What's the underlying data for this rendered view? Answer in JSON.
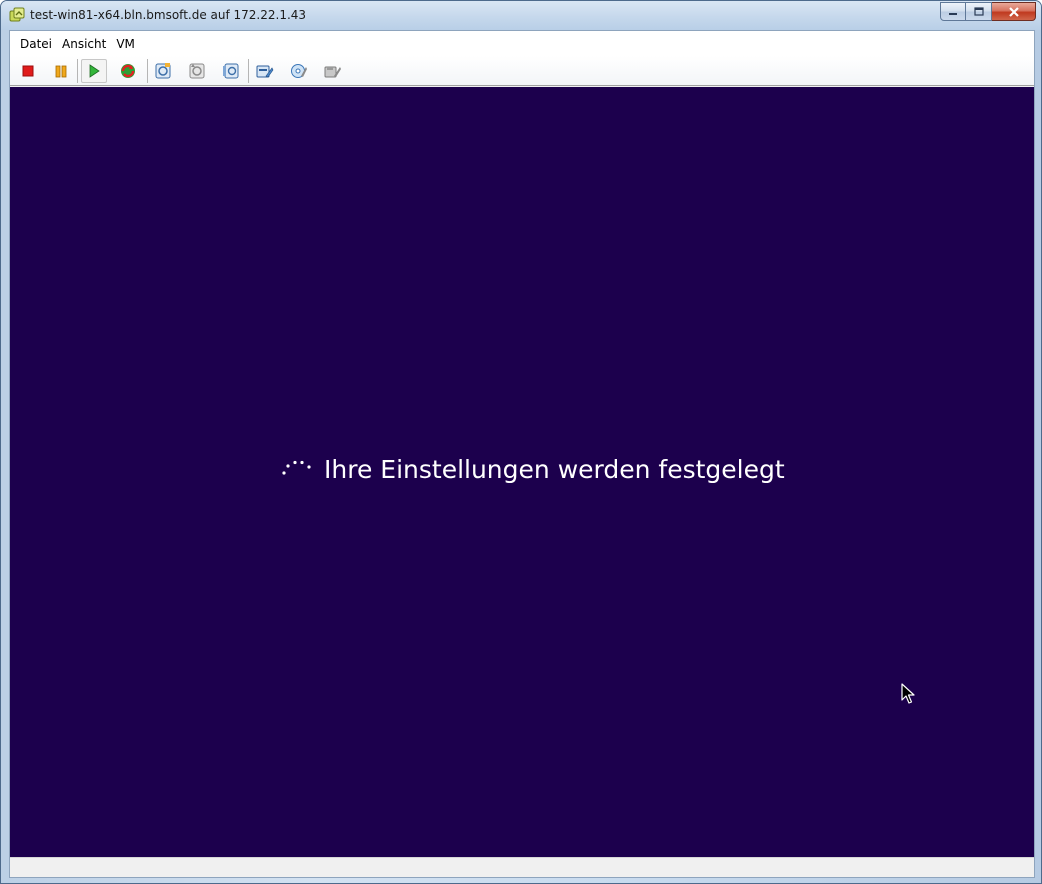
{
  "window": {
    "title": "test-win81-x64.bln.bmsoft.de auf 172.22.1.43"
  },
  "menu": {
    "items": [
      {
        "label": "Datei"
      },
      {
        "label": "Ansicht"
      },
      {
        "label": "VM"
      }
    ]
  },
  "toolbar": {
    "buttons": [
      {
        "name": "power-off-icon"
      },
      {
        "name": "suspend-icon"
      },
      {
        "name": "power-on-icon",
        "pressed": true
      },
      {
        "name": "reset-icon"
      },
      {
        "name": "snapshot-take-icon"
      },
      {
        "name": "snapshot-revert-icon"
      },
      {
        "name": "snapshot-manager-icon"
      },
      {
        "name": "edit-settings-icon"
      },
      {
        "name": "connect-cd-icon"
      },
      {
        "name": "connect-floppy-icon"
      }
    ]
  },
  "console": {
    "status_text": "Ihre Einstellungen werden festgelegt",
    "background_color": "#1c004d"
  }
}
